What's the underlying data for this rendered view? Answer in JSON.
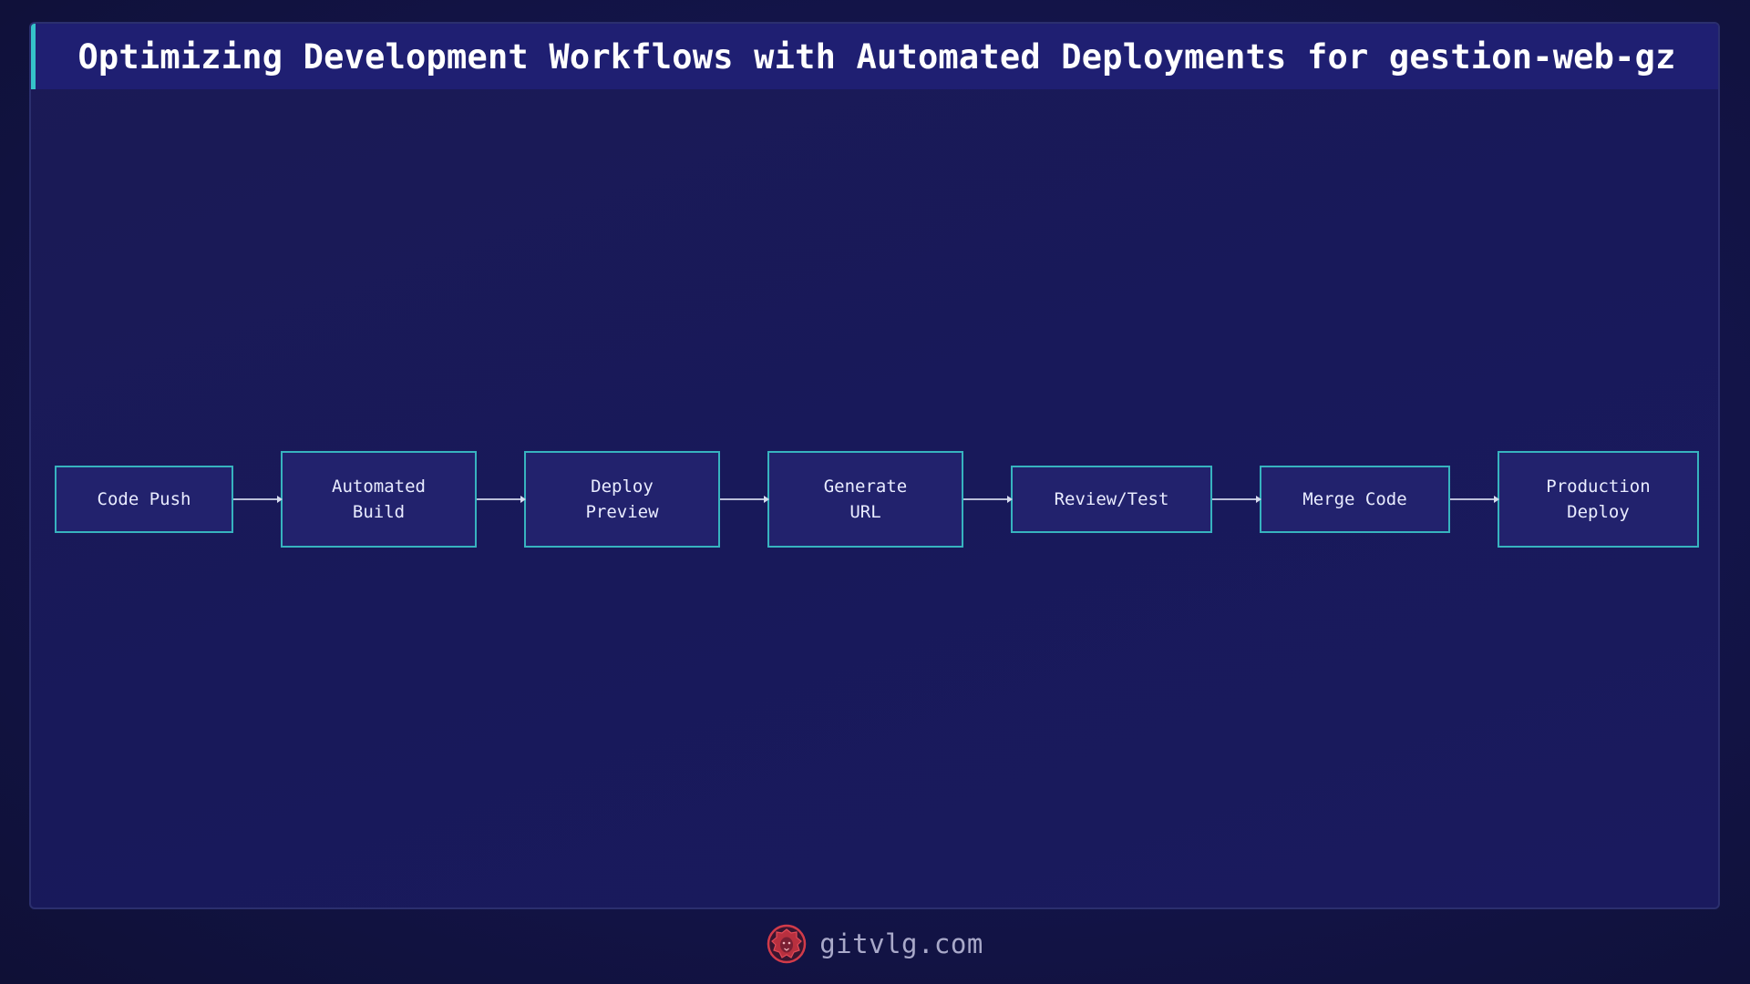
{
  "title": "Optimizing Development Workflows with Automated Deployments for gestion-web-gz",
  "nodes": [
    {
      "label": "Code Push"
    },
    {
      "label": "Automated\nBuild"
    },
    {
      "label": "Deploy\nPreview"
    },
    {
      "label": "Generate\nURL"
    },
    {
      "label": "Review/Test"
    },
    {
      "label": "Merge Code"
    },
    {
      "label": "Production\nDeploy"
    }
  ],
  "edges": [
    {
      "from": "Code Push",
      "to": "Automated Build"
    },
    {
      "from": "Automated Build",
      "to": "Deploy Preview"
    },
    {
      "from": "Deploy Preview",
      "to": "Generate URL"
    },
    {
      "from": "Generate URL",
      "to": "Review/Test"
    },
    {
      "from": "Review/Test",
      "to": "Merge Code"
    },
    {
      "from": "Merge Code",
      "to": "Production Deploy"
    }
  ],
  "footer": {
    "site": "gitvlg.com",
    "logo_icon": "lion-logo-icon"
  },
  "colors": {
    "accent": "#35c2c9",
    "node_fill": "#22226d",
    "node_border": "#37b3bf",
    "logo": "#d23b4a"
  }
}
